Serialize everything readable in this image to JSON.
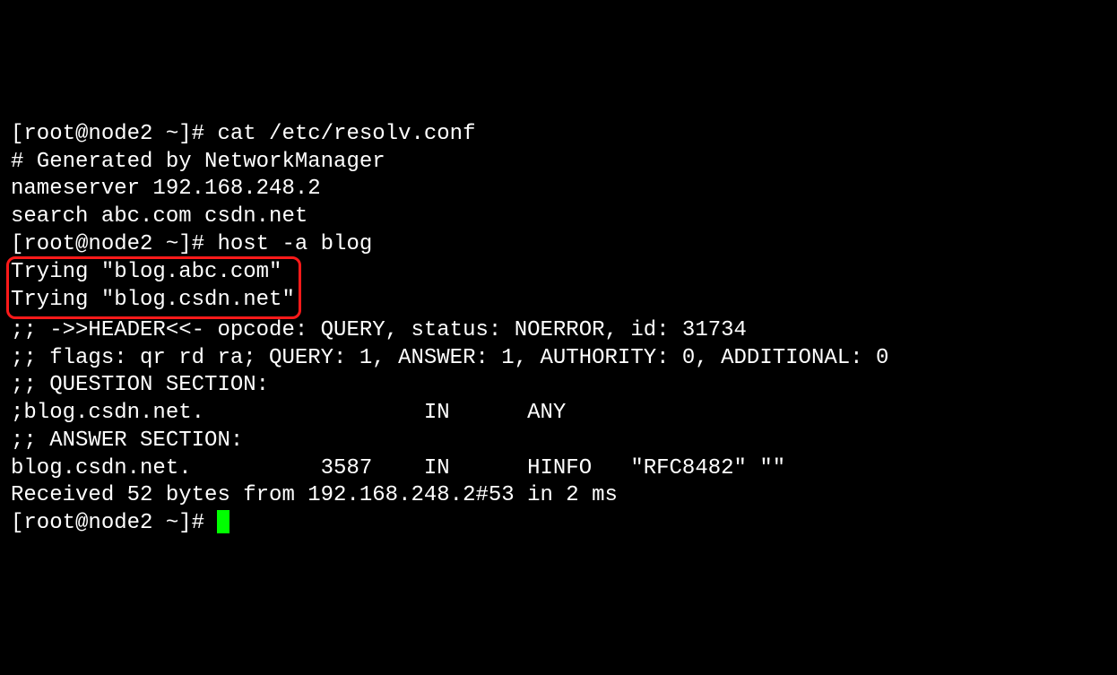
{
  "terminal": {
    "prompt1": "[root@node2 ~]# ",
    "cmd1": "cat /etc/resolv.conf",
    "out_cat_1": "# Generated by NetworkManager",
    "out_cat_2": "nameserver 192.168.248.2",
    "out_cat_3": "search abc.com csdn.net",
    "prompt2": "[root@node2 ~]# ",
    "cmd2": "host -a blog",
    "trying1": "Trying \"blog.abc.com\"",
    "trying2": "Trying \"blog.csdn.net\"",
    "header1": ";; ->>HEADER<<- opcode: QUERY, status: NOERROR, id: 31734",
    "header2": ";; flags: qr rd ra; QUERY: 1, ANSWER: 1, AUTHORITY: 0, ADDITIONAL: 0",
    "blank1": "",
    "qsection_hdr": ";; QUESTION SECTION:",
    "qsection_row": ";blog.csdn.net.\t\t\tIN\tANY",
    "blank2": "",
    "asection_hdr": ";; ANSWER SECTION:",
    "asection_row": "blog.csdn.net.\t\t3587\tIN\tHINFO\t\"RFC8482\" \"\"",
    "blank3": "",
    "received": "Received 52 bytes from 192.168.248.2#53 in 2 ms",
    "prompt3": "[root@node2 ~]# "
  }
}
